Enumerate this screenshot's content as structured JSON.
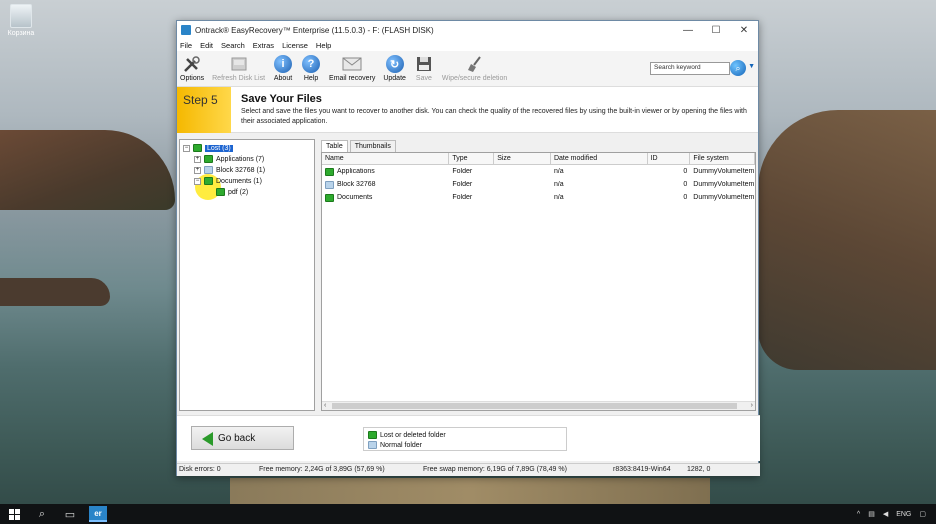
{
  "desktop": {
    "recycle_bin_label": "Корзина"
  },
  "window": {
    "title": "Ontrack® EasyRecovery™ Enterprise (11.5.0.3) - F: (FLASH DISK)",
    "minimize": "—",
    "maximize": "☐",
    "close": "✕"
  },
  "menu": [
    "File",
    "Edit",
    "Search",
    "Extras",
    "License",
    "Help"
  ],
  "toolbar": {
    "options": "Options",
    "refresh": "Refresh Disk List",
    "about": "About",
    "help": "Help",
    "email": "Email recovery",
    "update": "Update",
    "save": "Save",
    "wipe": "Wipe/secure deletion",
    "search_placeholder": "Search keyword"
  },
  "banner": {
    "step": "Step 5",
    "title": "Save Your Files",
    "desc": "Select and save the files you want to recover to another disk. You can check the quality of the recovered files by using the built-in viewer or by opening the files with their associated application."
  },
  "tree": {
    "root": "Lost (3)",
    "items": [
      "Applications (7)",
      "Block 32768 (1)",
      "Documents (1)",
      "pdf (2)"
    ]
  },
  "tabs": [
    "Table",
    "Thumbnails"
  ],
  "table": {
    "columns": [
      "Name",
      "Type",
      "Size",
      "Date modified",
      "ID",
      "File system"
    ],
    "rows": [
      {
        "name": "Applications",
        "type": "Folder",
        "size": "",
        "date": "n/a",
        "id": "0",
        "fs": "DummyVolumeItem"
      },
      {
        "name": "Block 32768",
        "type": "Folder",
        "size": "",
        "date": "n/a",
        "id": "0",
        "fs": "DummyVolumeItem"
      },
      {
        "name": "Documents",
        "type": "Folder",
        "size": "",
        "date": "n/a",
        "id": "0",
        "fs": "DummyVolumeItem"
      }
    ]
  },
  "bottom": {
    "go_back": "Go back",
    "legend_lost": "Lost or deleted folder",
    "legend_normal": "Normal folder"
  },
  "status": {
    "disk_errors": "Disk errors: 0",
    "free_mem": "Free memory: 2,24G of 3,89G (57,69 %)",
    "free_swap": "Free swap memory: 6,19G of 7,89G (78,49 %)",
    "build": "r8363:8419-Win64",
    "coords": "1282, 0"
  },
  "taskbar": {
    "app_label": "er",
    "lang": "ENG"
  }
}
